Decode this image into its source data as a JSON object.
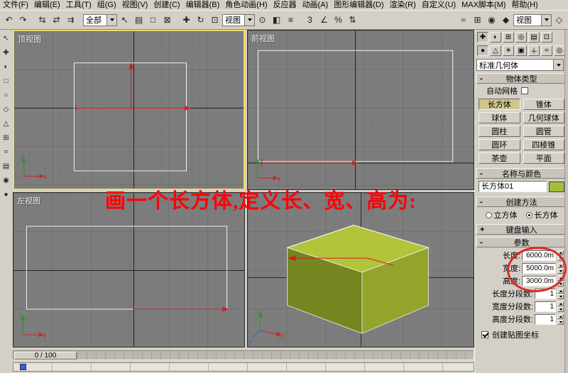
{
  "menu": {
    "items": [
      "文件(F)",
      "编辑(E)",
      "工具(T)",
      "组(G)",
      "视图(V)",
      "创建(C)",
      "编辑器(B)",
      "角色动画(H)",
      "反应器",
      "动画(A)",
      "图形编辑器(D)",
      "渲染(R)",
      "自定义(U)",
      "MAX脚本(M)",
      "帮助(H)"
    ]
  },
  "toolbar": {
    "selection_filter": "全部",
    "reference_coord": "视图",
    "render_type": "视图",
    "icons": [
      {
        "name": "undo",
        "glyph": "↶"
      },
      {
        "name": "redo",
        "glyph": "↷"
      },
      {
        "name": "select-and-link",
        "glyph": "⇆"
      },
      {
        "name": "unlink-selection",
        "glyph": "⇄"
      },
      {
        "name": "bind-to-space-warp",
        "glyph": "⇉"
      },
      {
        "name": "select-object",
        "glyph": "↖"
      },
      {
        "name": "select-by-name",
        "glyph": "▤"
      },
      {
        "name": "rect-selection-region",
        "glyph": "□"
      },
      {
        "name": "window-crossing",
        "glyph": "⊠"
      },
      {
        "name": "select-and-move",
        "glyph": "✚"
      },
      {
        "name": "select-and-rotate",
        "glyph": "↻"
      },
      {
        "name": "select-and-scale",
        "glyph": "⊡"
      },
      {
        "name": "use-pivot-center",
        "glyph": "⊙"
      },
      {
        "name": "mirror",
        "glyph": "◧"
      },
      {
        "name": "align",
        "glyph": "≡"
      },
      {
        "name": "snap-3d",
        "glyph": "3"
      },
      {
        "name": "angle-snap",
        "glyph": "∠"
      },
      {
        "name": "percent-snap",
        "glyph": "%"
      },
      {
        "name": "spinner-snap",
        "glyph": "⇅"
      },
      {
        "name": "curve-editor",
        "glyph": "≈"
      },
      {
        "name": "schematic-view",
        "glyph": "⊞"
      },
      {
        "name": "material-editor",
        "glyph": "◉"
      },
      {
        "name": "render-scene",
        "glyph": "◆"
      },
      {
        "name": "quick-render",
        "glyph": "◇"
      }
    ]
  },
  "left_toolbar": [
    {
      "name": "tool-1",
      "glyph": "↖"
    },
    {
      "name": "tool-2",
      "glyph": "✚"
    },
    {
      "name": "tool-3",
      "glyph": "◐"
    },
    {
      "name": "tool-4",
      "glyph": "□"
    },
    {
      "name": "tool-5",
      "glyph": "○"
    },
    {
      "name": "tool-6",
      "glyph": "◇"
    },
    {
      "name": "tool-7",
      "glyph": "△"
    },
    {
      "name": "tool-8",
      "glyph": "⊞"
    },
    {
      "name": "tool-9",
      "glyph": "≈"
    },
    {
      "name": "tool-10",
      "glyph": "▤"
    },
    {
      "name": "tool-11",
      "glyph": "◉"
    },
    {
      "name": "tool-12",
      "glyph": "●"
    }
  ],
  "viewports": {
    "top_label": "顶视图",
    "front_label": "前视图",
    "left_label": "左视图"
  },
  "axes": {
    "x": "x",
    "y": "y",
    "z": "z"
  },
  "annotation": {
    "text": "画一个长方体,定义长、宽、高为:",
    "color": "#ff0000"
  },
  "panel": {
    "tabs": [
      {
        "name": "create",
        "glyph": "✚"
      },
      {
        "name": "modify",
        "glyph": "◐"
      },
      {
        "name": "hierarchy",
        "glyph": "⊞"
      },
      {
        "name": "motion",
        "glyph": "◎"
      },
      {
        "name": "display",
        "glyph": "▤"
      },
      {
        "name": "utilities",
        "glyph": "⊡"
      }
    ],
    "categories": [
      {
        "name": "geometry",
        "glyph": "●"
      },
      {
        "name": "shapes",
        "glyph": "△"
      },
      {
        "name": "lights",
        "glyph": "☀"
      },
      {
        "name": "cameras",
        "glyph": "▣"
      },
      {
        "name": "helpers",
        "glyph": "＋"
      },
      {
        "name": "space-warps",
        "glyph": "≈"
      },
      {
        "name": "systems",
        "glyph": "◎"
      }
    ],
    "subtype_dropdown": "标准几何体",
    "object_type": {
      "title": "物体类型",
      "expand": "-",
      "autogrid_label": "自动网格",
      "buttons": [
        "长方体",
        "锥体",
        "球体",
        "几何球体",
        "圆柱",
        "圆管",
        "圆环",
        "四棱锥",
        "茶壶",
        "平面"
      ],
      "active_button": "长方体"
    },
    "name_color": {
      "title": "名称与颜色",
      "expand": "-",
      "name_value": "长方体01",
      "swatch_color": "#a6bc3c"
    },
    "creation_method": {
      "title": "创建方法",
      "expand": "-",
      "radio_cube": "立方体",
      "radio_box": "长方体",
      "selected": "长方体"
    },
    "keyboard_entry": {
      "title": "键盘输入",
      "expand": "+"
    },
    "parameters": {
      "title": "参数",
      "expand": "-",
      "length_label": "长度:",
      "length_value": "6000.0m",
      "width_label": "宽度:",
      "width_value": "5000.0m",
      "height_label": "高度:",
      "height_value": "3000.0m",
      "length_segs_label": "长度分段数:",
      "length_segs_value": "1",
      "width_segs_label": "宽度分段数:",
      "width_segs_value": "1",
      "height_segs_label": "高度分段数:",
      "height_segs_value": "1",
      "mapping_label": "创建贴图坐标",
      "mapping_checked": true
    }
  },
  "timeline": {
    "slider_label": "0 / 100"
  },
  "colors": {
    "active_viewport_border": "#f0dd62",
    "box_top_face": "#b3c33a",
    "box_left_face": "#75851f",
    "box_right_face": "#93a32b",
    "name_swatch": "#a6bc3c",
    "annotation_red": "#ff0008"
  }
}
